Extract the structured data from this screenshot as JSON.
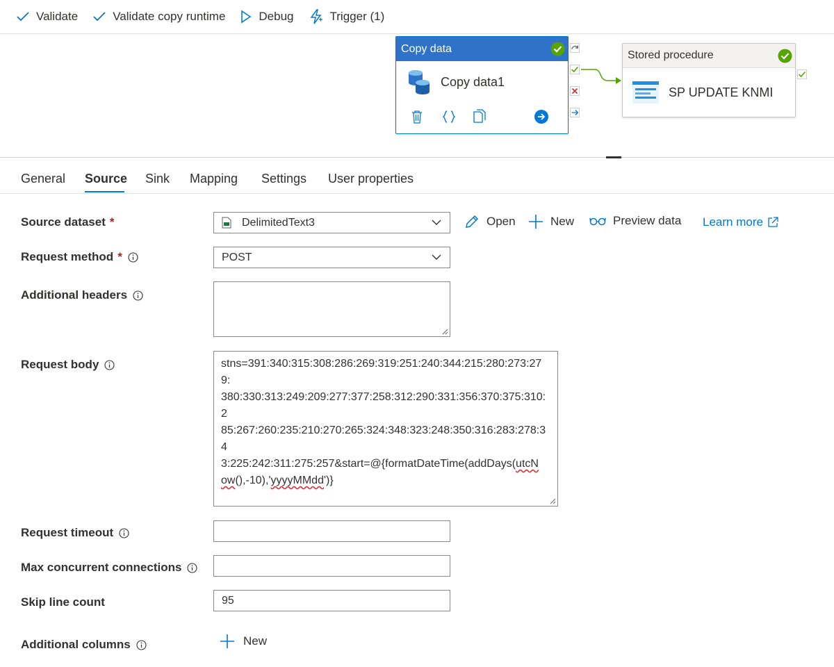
{
  "toolbar": {
    "validate": "Validate",
    "validate_copy_runtime": "Validate copy runtime",
    "debug": "Debug",
    "trigger": "Trigger (1)"
  },
  "canvas": {
    "copy_activity": {
      "type": "Copy data",
      "name": "Copy data1"
    },
    "sp_activity": {
      "type": "Stored procedure",
      "name": "SP UPDATE KNMI"
    }
  },
  "tabs": [
    "General",
    "Source",
    "Sink",
    "Mapping",
    "Settings",
    "User properties"
  ],
  "active_tab": "Source",
  "form": {
    "source_dataset": {
      "label": "Source dataset",
      "value": "DelimitedText3"
    },
    "actions": {
      "open": "Open",
      "new": "New",
      "preview": "Preview data",
      "learn_more": "Learn more"
    },
    "request_method": {
      "label": "Request method",
      "value": "POST"
    },
    "additional_headers": {
      "label": "Additional headers",
      "value": ""
    },
    "request_body": {
      "label": "Request body",
      "line1": "stns=391:340:315:308:286:269:319:251:240:344:215:280:273:279:",
      "line2": "380:330:313:249:209:277:377:258:312:290:331:356:370:375:310:2",
      "line3": "85:267:260:235:210:270:265:324:348:323:248:350:316:283:278:34",
      "line4a": "3:225:242:311:275:257&start=@{formatDateTime(addDays(",
      "line4b": "utcN",
      "line5a": "ow",
      "line5b": "(),-10),'",
      "line5c": "yyyyMMdd",
      "line5d": "')}"
    },
    "request_timeout": {
      "label": "Request timeout",
      "value": ""
    },
    "max_concurrent": {
      "label": "Max concurrent connections",
      "value": ""
    },
    "skip_line_count": {
      "label": "Skip line count",
      "value": "95"
    },
    "additional_columns": {
      "label": "Additional columns",
      "new_label": "New"
    }
  },
  "colors": {
    "accent": "#0078d4",
    "success": "#57a300",
    "required": "#a4262c",
    "copy_header": "#2e73c9"
  }
}
